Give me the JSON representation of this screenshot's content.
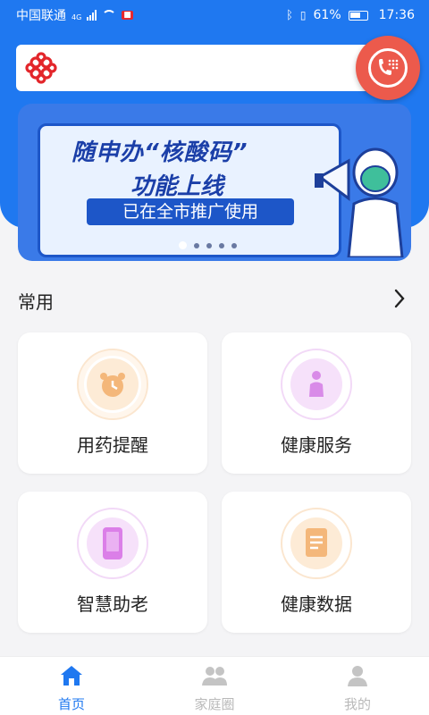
{
  "statusbar": {
    "carrier": "中国联通",
    "network": "4G",
    "battery": "61%",
    "time": "17:36"
  },
  "header": {
    "logo_icon": "china-unicom-logo",
    "call_icon": "phone-dialpad-icon"
  },
  "banner": {
    "line1": "随申办“核酸码”",
    "line2": "功能上线",
    "pill": "已在全市推广使用",
    "page_count": 5,
    "active_index": 0
  },
  "section": {
    "title": "常用",
    "more_icon": "chevron-right-icon"
  },
  "cards": [
    {
      "label": "用药提醒",
      "icon": "alarm-clock-icon",
      "color": "#f0a860"
    },
    {
      "label": "健康服务",
      "icon": "caregiver-icon",
      "color": "#d77be6"
    },
    {
      "label": "智慧助老",
      "icon": "smartphone-icon",
      "color": "#d77be6"
    },
    {
      "label": "健康数据",
      "icon": "document-icon",
      "color": "#f0a860"
    }
  ],
  "nav": {
    "items": [
      {
        "label": "首页",
        "icon": "home-icon",
        "active": true
      },
      {
        "label": "家庭圈",
        "icon": "family-icon",
        "active": false
      },
      {
        "label": "我的",
        "icon": "profile-icon",
        "active": false
      }
    ],
    "active_color": "#1f78f0",
    "inactive_color": "#b9b9b9"
  }
}
